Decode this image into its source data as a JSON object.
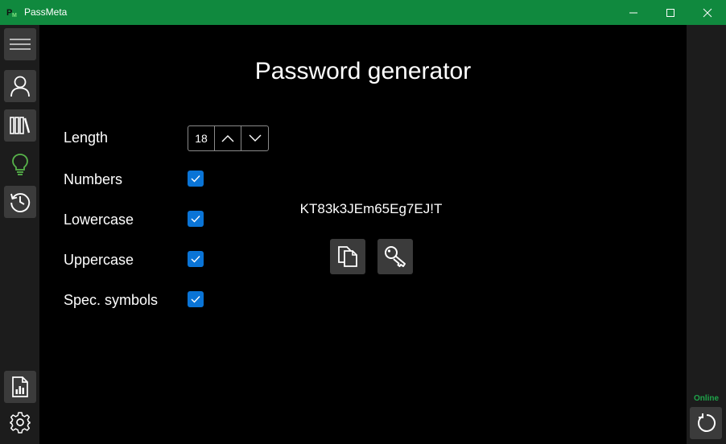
{
  "window": {
    "title": "PassMeta"
  },
  "sidebar_left": {
    "items": [
      {
        "icon": "menu-icon"
      },
      {
        "icon": "user-icon"
      },
      {
        "icon": "library-icon"
      },
      {
        "icon": "lightbulb-icon"
      },
      {
        "icon": "history-icon"
      },
      {
        "icon": "report-icon"
      },
      {
        "icon": "gear-icon"
      }
    ]
  },
  "main": {
    "title": "Password generator",
    "options": {
      "length_label": "Length",
      "length_value": "18",
      "numbers_label": "Numbers",
      "numbers_checked": true,
      "lowercase_label": "Lowercase",
      "lowercase_checked": true,
      "uppercase_label": "Uppercase",
      "uppercase_checked": true,
      "special_label": "Spec. symbols",
      "special_checked": true
    },
    "generated_password": "KT83k3JEm65Eg7EJ!T",
    "actions": [
      {
        "icon": "copy-icon"
      },
      {
        "icon": "key-icon"
      }
    ]
  },
  "sidebar_right": {
    "status": "Online",
    "refresh_icon": "refresh-icon"
  },
  "colors": {
    "titlebar": "#10893e",
    "sidebar": "#1c1c1c",
    "button": "#3b3b3b",
    "accent_checkbox": "#0a74d6",
    "active_icon": "#57b34a",
    "online_status": "#1fa34a"
  }
}
